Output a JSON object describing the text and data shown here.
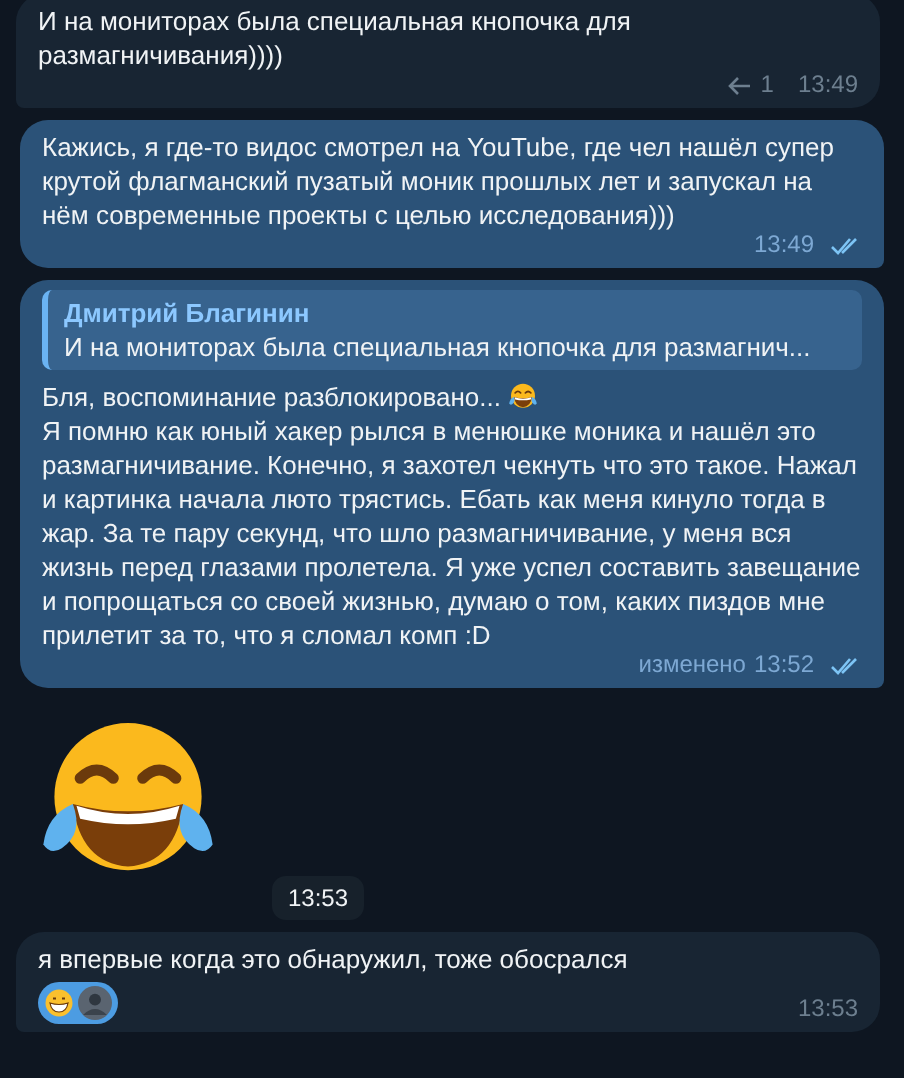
{
  "messages": [
    {
      "kind": "text",
      "outgoing": false,
      "paragraphs": [
        {
          "text": "И на мониторах была специальная кнопочка для размагничивания))))",
          "emoji": false
        }
      ],
      "replies": "1",
      "time": "13:49"
    },
    {
      "kind": "text",
      "outgoing": true,
      "read": true,
      "paragraphs": [
        {
          "text": "Кажись, я где-то видос смотрел на YouTube, где чел нашёл супер крутой флагманский пузатый моник прошлых лет и запускал на нём современные проекты с целью исследования)))",
          "emoji": false
        }
      ],
      "time": "13:49"
    },
    {
      "kind": "text",
      "outgoing": true,
      "read": true,
      "quote": {
        "author": "Дмитрий Благинин",
        "text": "И на мониторах была специальная кнопочка для размагнич..."
      },
      "paragraphs": [
        {
          "text": "Бля, воспоминание разблокировано...",
          "emoji": true
        },
        {
          "text": "Я помню как юный хакер рылся в менюшке моника и нашёл это размагничивание. Конечно, я захотел чекнуть что это такое. Нажал и картинка начала люто трястись. Ебать как меня кинуло тогда в жар. За те пару секунд, что шло размагничивание, у меня вся жизнь перед глазами пролетела. Я уже успел составить завещание и попрощаться со своей жизнью, думаю о том, каких пиздов мне прилетит за то, что я сломал комп :D",
          "emoji": false
        }
      ],
      "edited": "изменено",
      "time": "13:52"
    },
    {
      "kind": "sticker",
      "time": "13:53"
    },
    {
      "kind": "text",
      "outgoing": false,
      "paragraphs": [
        {
          "text": "я впервые когда это обнаружил, тоже обосрался",
          "emoji": false
        }
      ],
      "reactions": [
        {
          "selected": true
        }
      ],
      "time": "13:53"
    }
  ]
}
